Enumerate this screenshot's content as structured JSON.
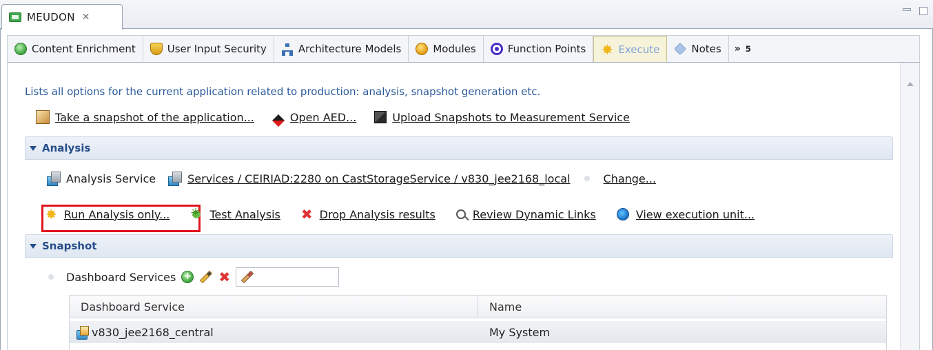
{
  "editor_tab": {
    "title": "MEUDON",
    "close_glyph": "✕"
  },
  "subtabs": [
    {
      "label": "Content Enrichment",
      "icon": "green-circle-icon"
    },
    {
      "label": "User Input Security",
      "icon": "shield-icon"
    },
    {
      "label": "Architecture Models",
      "icon": "architecture-icon"
    },
    {
      "label": "Modules",
      "icon": "modules-icon"
    },
    {
      "label": "Function Points",
      "icon": "function-points-icon"
    },
    {
      "label": "Execute",
      "icon": "execute-burst-icon",
      "active": true
    },
    {
      "label": "Notes",
      "icon": "tag-icon"
    }
  ],
  "subtabs_more": {
    "chevrons": "»",
    "count": "5"
  },
  "description": "Lists all options for the current application related to production: analysis, snapshot generation etc.",
  "top_actions": {
    "snapshot": "Take a snapshot of the application...",
    "open_aed": "Open AED...",
    "upload": "Upload Snapshots to Measurement Service"
  },
  "analysis": {
    "title": "Analysis",
    "service_label": "Analysis Service",
    "service_link": "Services / CEIRIAD:2280 on CastStorageService / v830_jee2168_local",
    "change": "Change...",
    "actions": {
      "run": "Run Analysis only...",
      "test": "Test Analysis",
      "drop": "Drop Analysis results",
      "review": "Review Dynamic Links",
      "view": "View execution unit..."
    }
  },
  "snapshot": {
    "title": "Snapshot",
    "dashboard_label": "Dashboard Services",
    "filter_value": "",
    "table": {
      "headers": [
        "Dashboard Service",
        "Name"
      ],
      "rows": [
        {
          "service": "v830_jee2168_central",
          "name": "My System"
        }
      ]
    }
  },
  "colors": {
    "accent_blue": "#274f8a",
    "highlight_red": "#e0141e",
    "active_tab_text": "#7fa4d8"
  }
}
